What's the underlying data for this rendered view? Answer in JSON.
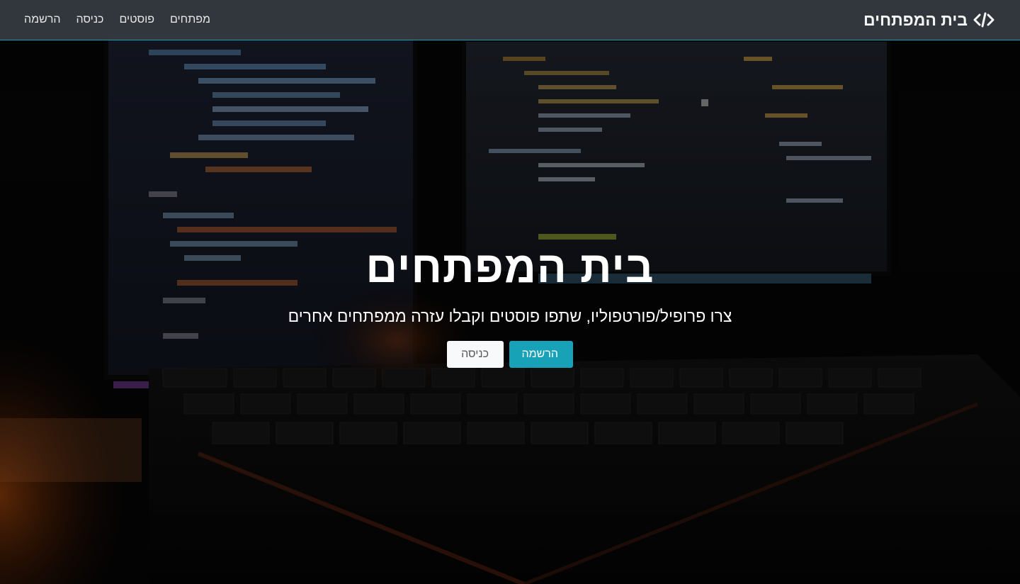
{
  "navbar": {
    "brand_text": "בית המפתחים",
    "brand_icon": "code-icon",
    "links": [
      {
        "label": "מפתחים"
      },
      {
        "label": "פוסטים"
      },
      {
        "label": "כניסה"
      },
      {
        "label": "הרשמה"
      }
    ]
  },
  "hero": {
    "title": "בית המפתחים",
    "lead": "צרו פרופיל/פורטפוליו, שתפו פוסטים וקבלו עזרה ממפתחים אחרים",
    "register_button": "הרשמה",
    "login_button": "כניסה"
  },
  "colors": {
    "navbar_bg": "#343a40",
    "accent": "#17a2b8",
    "light_button": "#f8f9fa"
  }
}
